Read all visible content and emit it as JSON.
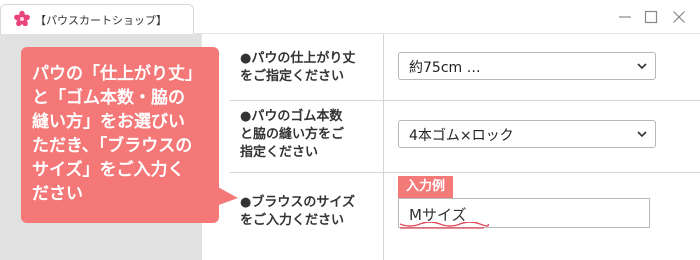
{
  "window": {
    "tab_title": "【パウスカートショップ】",
    "controls": [
      "minimize",
      "maximize",
      "close"
    ]
  },
  "callout": {
    "text": "パウの「仕上がり丈」\nと「ゴム本数・脇の\n縫い方」をお選びい\nただき、「ブラウスの\nサイズ」をご入力く\nださい"
  },
  "form": {
    "rows": [
      {
        "label": "●パウの仕上がり丈\nをご指定ください",
        "value": "約75cm …"
      },
      {
        "label": "●パウのゴム本数\nと脇の縫い方をご\n指定ください",
        "value": "4本ゴム×ロック"
      },
      {
        "label": "●ブラウスのサイズ\nをご入力ください",
        "example_badge": "入力例",
        "value": "Mサイズ"
      }
    ]
  },
  "colors": {
    "accent": "#f47878",
    "left_pane": "#e1e1e1",
    "logo": "#e8447a"
  }
}
